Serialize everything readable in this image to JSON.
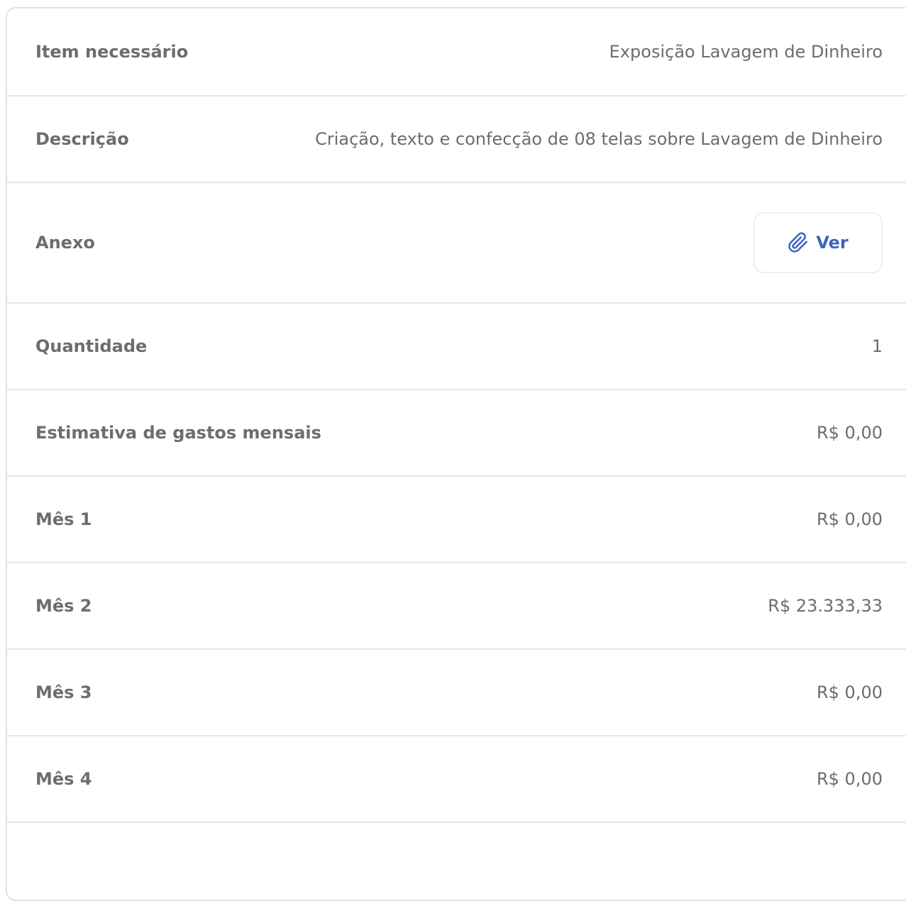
{
  "details": {
    "item": {
      "label": "Item necessário",
      "value": "Exposição Lavagem de Dinheiro"
    },
    "description": {
      "label": "Descrição",
      "value": "Criação, texto e confecção de 08 telas sobre Lavagem de Dinheiro"
    },
    "attachment": {
      "label": "Anexo",
      "button_label": "Ver",
      "button_icon": "paperclip-icon"
    },
    "quantity": {
      "label": "Quantidade",
      "value": "1"
    },
    "monthly_estimate": {
      "label": "Estimativa de gastos mensais",
      "value": "R$ 0,00"
    },
    "months": [
      {
        "label": "Mês 1",
        "value": "R$ 0,00"
      },
      {
        "label": "Mês 2",
        "value": "R$ 23.333,33"
      },
      {
        "label": "Mês 3",
        "value": "R$ 0,00"
      },
      {
        "label": "Mês 4",
        "value": "R$ 0,00"
      }
    ]
  },
  "colors": {
    "text": "#6d6d6d",
    "accent": "#3f63c4",
    "divider": "#e6e6e6",
    "card_border": "#e2e2e2"
  }
}
